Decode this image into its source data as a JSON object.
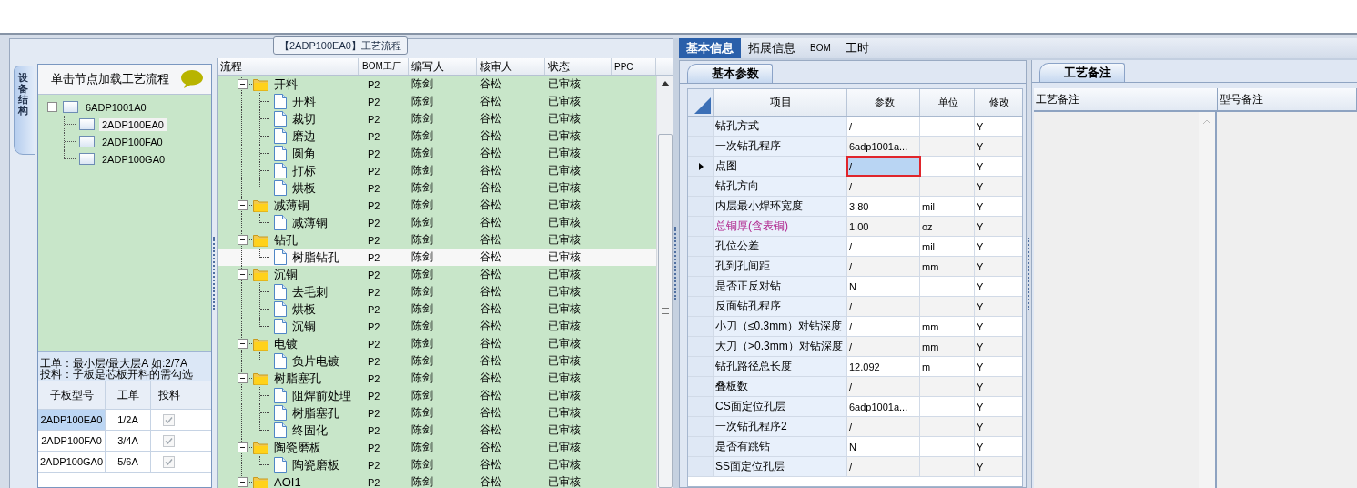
{
  "process_panel": {
    "title": "【2ADP100EA0】工艺流程"
  },
  "side_tab": {
    "label": "设备结构"
  },
  "structure": {
    "hint": "单击节点加载工艺流程",
    "tree": [
      {
        "label": "6ADP1001A0",
        "expanded": true,
        "selected": false,
        "children": [
          {
            "label": "2ADP100EA0",
            "selected": true
          },
          {
            "label": "2ADP100FA0",
            "selected": false
          },
          {
            "label": "2ADP100GA0",
            "selected": false
          }
        ]
      }
    ],
    "notes": [
      "工单：最小层/最大层A 如:2/7A",
      "投料：子板是芯板开料的需勾选"
    ],
    "table": {
      "columns": [
        "子板型号",
        "工单",
        "投料"
      ],
      "rows": [
        {
          "model": "2ADP100EA0",
          "order": "1/2A",
          "feed": true,
          "selected": true
        },
        {
          "model": "2ADP100FA0",
          "order": "3/4A",
          "feed": true,
          "selected": false
        },
        {
          "model": "2ADP100GA0",
          "order": "5/6A",
          "feed": true,
          "selected": false
        }
      ]
    }
  },
  "flow": {
    "columns": [
      "流程",
      "BOM工厂",
      "编写人",
      "核审人",
      "状态",
      "PPC"
    ],
    "groups": [
      {
        "name": "开料",
        "bom": "P2",
        "author": "陈剑",
        "reviewer": "谷松",
        "status": "已审核",
        "expanded": true,
        "selected": false,
        "children": [
          {
            "name": "开料",
            "bom": "P2",
            "author": "陈剑",
            "reviewer": "谷松",
            "status": "已审核",
            "selected": false
          },
          {
            "name": "裁切",
            "bom": "P2",
            "author": "陈剑",
            "reviewer": "谷松",
            "status": "已审核",
            "selected": false
          },
          {
            "name": "磨边",
            "bom": "P2",
            "author": "陈剑",
            "reviewer": "谷松",
            "status": "已审核",
            "selected": false
          },
          {
            "name": "圆角",
            "bom": "P2",
            "author": "陈剑",
            "reviewer": "谷松",
            "status": "已审核",
            "selected": false
          },
          {
            "name": "打标",
            "bom": "P2",
            "author": "陈剑",
            "reviewer": "谷松",
            "status": "已审核",
            "selected": false
          },
          {
            "name": "烘板",
            "bom": "P2",
            "author": "陈剑",
            "reviewer": "谷松",
            "status": "已审核",
            "selected": false
          }
        ]
      },
      {
        "name": "减薄铜",
        "bom": "P2",
        "author": "陈剑",
        "reviewer": "谷松",
        "status": "已审核",
        "expanded": true,
        "selected": false,
        "children": [
          {
            "name": "减薄铜",
            "bom": "P2",
            "author": "陈剑",
            "reviewer": "谷松",
            "status": "已审核",
            "selected": false
          }
        ]
      },
      {
        "name": "钻孔",
        "bom": "P2",
        "author": "陈剑",
        "reviewer": "谷松",
        "status": "已审核",
        "expanded": true,
        "selected": false,
        "children": [
          {
            "name": "树脂钻孔",
            "bom": "P2",
            "author": "陈剑",
            "reviewer": "谷松",
            "status": "已审核",
            "selected": true
          }
        ]
      },
      {
        "name": "沉铜",
        "bom": "P2",
        "author": "陈剑",
        "reviewer": "谷松",
        "status": "已审核",
        "expanded": true,
        "selected": false,
        "children": [
          {
            "name": "去毛刺",
            "bom": "P2",
            "author": "陈剑",
            "reviewer": "谷松",
            "status": "已审核",
            "selected": false
          },
          {
            "name": "烘板",
            "bom": "P2",
            "author": "陈剑",
            "reviewer": "谷松",
            "status": "已审核",
            "selected": false
          },
          {
            "name": "沉铜",
            "bom": "P2",
            "author": "陈剑",
            "reviewer": "谷松",
            "status": "已审核",
            "selected": false
          }
        ]
      },
      {
        "name": "电镀",
        "bom": "P2",
        "author": "陈剑",
        "reviewer": "谷松",
        "status": "已审核",
        "expanded": true,
        "selected": false,
        "children": [
          {
            "name": "负片电镀",
            "bom": "P2",
            "author": "陈剑",
            "reviewer": "谷松",
            "status": "已审核",
            "selected": false
          }
        ]
      },
      {
        "name": "树脂塞孔",
        "bom": "P2",
        "author": "陈剑",
        "reviewer": "谷松",
        "status": "已审核",
        "expanded": true,
        "selected": false,
        "children": [
          {
            "name": "阻焊前处理",
            "bom": "P2",
            "author": "陈剑",
            "reviewer": "谷松",
            "status": "已审核",
            "selected": false
          },
          {
            "name": "树脂塞孔",
            "bom": "P2",
            "author": "陈剑",
            "reviewer": "谷松",
            "status": "已审核",
            "selected": false
          },
          {
            "name": "终固化",
            "bom": "P2",
            "author": "陈剑",
            "reviewer": "谷松",
            "status": "已审核",
            "selected": false
          }
        ]
      },
      {
        "name": "陶瓷磨板",
        "bom": "P2",
        "author": "陈剑",
        "reviewer": "谷松",
        "status": "已审核",
        "expanded": true,
        "selected": false,
        "children": [
          {
            "name": "陶瓷磨板",
            "bom": "P2",
            "author": "陈剑",
            "reviewer": "谷松",
            "status": "已审核",
            "selected": false
          }
        ]
      },
      {
        "name": "AOI1",
        "bom": "P2",
        "author": "陈剑",
        "reviewer": "谷松",
        "status": "已审核",
        "expanded": true,
        "selected": false
      }
    ]
  },
  "tabs": [
    {
      "label": "基本信息",
      "selected": true
    },
    {
      "label": "拓展信息",
      "selected": false
    },
    {
      "label": "BOM",
      "selected": false
    },
    {
      "label": "工时",
      "selected": false
    }
  ],
  "params": {
    "tab": "基本参数",
    "columns": [
      "项目",
      "参数",
      "单位",
      "修改"
    ],
    "rows": [
      {
        "item": "钻孔方式",
        "value": "/",
        "unit": "",
        "modify": "Y",
        "selected": false,
        "emphasized": false
      },
      {
        "item": "一次钻孔程序",
        "value": "6adp1001a...",
        "unit": "",
        "modify": "Y",
        "selected": false,
        "emphasized": false
      },
      {
        "item": "点图",
        "value": "/",
        "unit": "",
        "modify": "Y",
        "selected": true,
        "emphasized": false
      },
      {
        "item": "钻孔方向",
        "value": "/",
        "unit": "",
        "modify": "Y",
        "selected": false,
        "emphasized": false
      },
      {
        "item": "内层最小焊环宽度",
        "value": "3.80",
        "unit": "mil",
        "modify": "Y",
        "selected": false,
        "emphasized": false
      },
      {
        "item": "总铜厚(含表铜)",
        "value": "1.00",
        "unit": "oz",
        "modify": "Y",
        "selected": false,
        "emphasized": true
      },
      {
        "item": "孔位公差",
        "value": "/",
        "unit": "mil",
        "modify": "Y",
        "selected": false,
        "emphasized": false
      },
      {
        "item": "孔到孔间距",
        "value": "/",
        "unit": "mm",
        "modify": "Y",
        "selected": false,
        "emphasized": false
      },
      {
        "item": "是否正反对钻",
        "value": "N",
        "unit": "",
        "modify": "Y",
        "selected": false,
        "emphasized": false
      },
      {
        "item": "反面钻孔程序",
        "value": "/",
        "unit": "",
        "modify": "Y",
        "selected": false,
        "emphasized": false
      },
      {
        "item": "小刀（≤0.3mm）对钻深度",
        "value": "/",
        "unit": "mm",
        "modify": "Y",
        "selected": false,
        "emphasized": false
      },
      {
        "item": "大刀（>0.3mm）对钻深度",
        "value": "/",
        "unit": "mm",
        "modify": "Y",
        "selected": false,
        "emphasized": false
      },
      {
        "item": "钻孔路径总长度",
        "value": "12.092",
        "unit": "m",
        "modify": "Y",
        "selected": false,
        "emphasized": false
      },
      {
        "item": "叠板数",
        "value": "/",
        "unit": "",
        "modify": "Y",
        "selected": false,
        "emphasized": false
      },
      {
        "item": "CS面定位孔层",
        "value": "6adp1001a...",
        "unit": "",
        "modify": "Y",
        "selected": false,
        "emphasized": false
      },
      {
        "item": "一次钻孔程序2",
        "value": "/",
        "unit": "",
        "modify": "Y",
        "selected": false,
        "emphasized": false
      },
      {
        "item": "是否有跳钻",
        "value": "N",
        "unit": "",
        "modify": "Y",
        "selected": false,
        "emphasized": false
      },
      {
        "item": "SS面定位孔层",
        "value": "/",
        "unit": "",
        "modify": "Y",
        "selected": false,
        "emphasized": false
      }
    ]
  },
  "remarks": {
    "tab": "工艺备注",
    "columns": [
      "工艺备注",
      "型号备注"
    ]
  }
}
